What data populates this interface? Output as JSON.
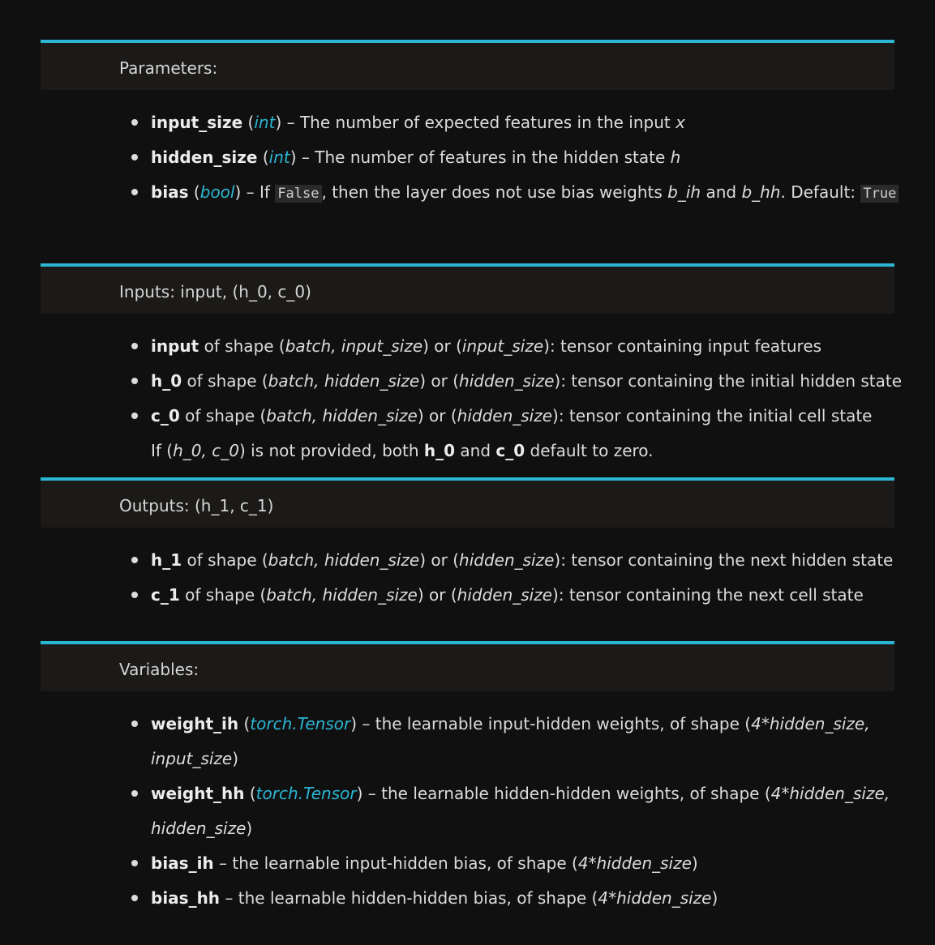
{
  "parameters": {
    "header": "Parameters:",
    "items": [
      {
        "name": "input_size",
        "open": " (",
        "type": "int",
        "close": ")",
        "desc": " – The number of expected features in the input ",
        "var": "x"
      },
      {
        "name": "hidden_size",
        "open": " (",
        "type": "int",
        "close": ")",
        "desc": " – The number of features in the hidden state ",
        "var": "h"
      },
      {
        "name": "bias",
        "open": " (",
        "type": "bool",
        "close": ")",
        "desc_a": " – If ",
        "code_a": "False",
        "desc_b": ", then the layer does not use bias weights ",
        "var_a": "b_ih",
        "desc_c": " and ",
        "var_b": "b_hh",
        "desc_d": ". Default: ",
        "code_b": "True"
      }
    ]
  },
  "inputs": {
    "header": "Inputs: input, (h_0, c_0)",
    "items": [
      {
        "name": "input",
        "t1": " of shape (",
        "v1": "batch, input_size",
        "t2": ") or (",
        "v2": "input_size",
        "t3": "): tensor containing input features"
      },
      {
        "name": "h_0",
        "t1": " of shape (",
        "v1": "batch, hidden_size",
        "t2": ") or (",
        "v2": "hidden_size",
        "t3": "): tensor containing the initial hidden state"
      },
      {
        "name": "c_0",
        "t1": " of shape (",
        "v1": "batch, hidden_size",
        "t2": ") or (",
        "v2": "hidden_size",
        "t3": "): tensor containing the initial cell state"
      }
    ],
    "note": {
      "t1": "If (",
      "v1": "h_0, c_0",
      "t2": ") is not provided, both ",
      "b1": "h_0",
      "t3": " and ",
      "b2": "c_0",
      "t4": " default to zero."
    }
  },
  "outputs": {
    "header": "Outputs: (h_1, c_1)",
    "items": [
      {
        "name": "h_1",
        "t1": " of shape (",
        "v1": "batch, hidden_size",
        "t2": ") or (",
        "v2": "hidden_size",
        "t3": "): tensor containing the next hidden state"
      },
      {
        "name": "c_1",
        "t1": " of shape (",
        "v1": "batch, hidden_size",
        "t2": ") or (",
        "v2": "hidden_size",
        "t3": "): tensor containing the next cell state"
      }
    ]
  },
  "variables": {
    "header": "Variables:",
    "items": [
      {
        "name": "weight_ih",
        "open": " (",
        "type": "torch.Tensor",
        "close": ")",
        "t1": " – the learnable input-hidden weights, of shape (",
        "v1": "4*hidden_size,",
        "v2": "input_size",
        "t2": ")"
      },
      {
        "name": "weight_hh",
        "open": " (",
        "type": "torch.Tensor",
        "close": ")",
        "t1": " – the learnable hidden-hidden weights, of shape (",
        "v1": "4*hidden_size,",
        "v2": "hidden_size",
        "t2": ")"
      },
      {
        "name": "bias_ih",
        "t1": " – the learnable input-hidden bias, of shape (",
        "v1": "4*hidden_size",
        "t2": ")"
      },
      {
        "name": "bias_hh",
        "t1": " – the learnable hidden-hidden bias, of shape (",
        "v1": "4*hidden_size",
        "t2": ")"
      }
    ]
  },
  "colors": {
    "accent": "#2bb6d3",
    "background": "#101010",
    "header_bg": "#1b1a18",
    "text": "#dcdcdc"
  }
}
